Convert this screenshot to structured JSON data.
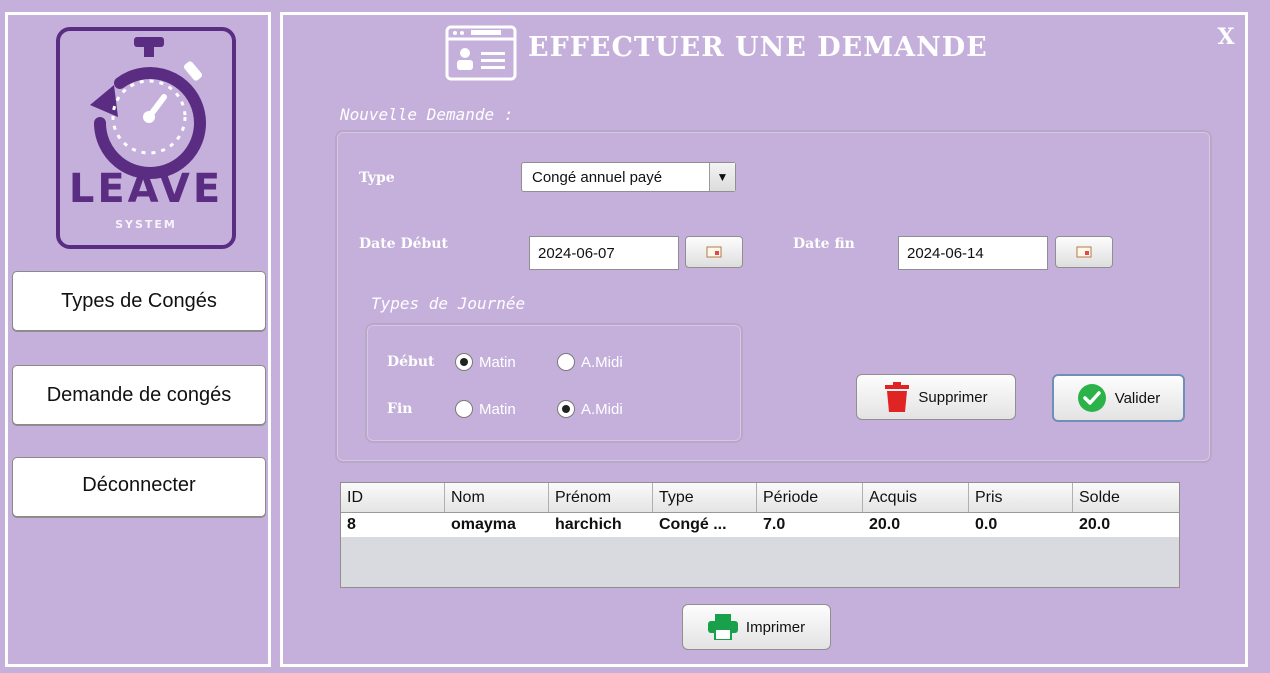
{
  "logo": {
    "title": "LEAVE",
    "subtitle": "SYSTEM"
  },
  "sidebar": {
    "items": [
      {
        "label": "Types de Congés"
      },
      {
        "label": "Demande de congés"
      },
      {
        "label": "Déconnecter"
      }
    ]
  },
  "header": {
    "title": "EFFECTUER UNE DEMANDE",
    "close": "X"
  },
  "form": {
    "section": "Nouvelle Demande :",
    "type_label": "Type",
    "type_value": "Congé annuel payé",
    "date_debut_label": "Date Début",
    "date_debut_value": "2024-06-07",
    "date_fin_label": "Date fin",
    "date_fin_value": "2024-06-14",
    "journee_label": "Types de Journée",
    "debut_label": "Début",
    "fin_label": "Fin",
    "matin": "Matin",
    "amidi": "A.Midi",
    "debut_selected": "Matin",
    "fin_selected": "A.Midi"
  },
  "actions": {
    "delete": "Supprimer",
    "validate": "Valider",
    "print": "Imprimer"
  },
  "table": {
    "columns": [
      "ID",
      "Nom",
      "Prénom",
      "Type",
      "Période",
      "Acquis",
      "Pris",
      "Solde"
    ],
    "rows": [
      [
        "8",
        "omayma",
        "harchich",
        "Congé ...",
        "7.0",
        "20.0",
        "0.0",
        "20.0"
      ]
    ]
  },
  "colors": {
    "background": "#c5b0dc",
    "brand": "#5a2d82",
    "valid": "#2bb34a",
    "delete": "#e02424",
    "print": "#18a04a"
  }
}
